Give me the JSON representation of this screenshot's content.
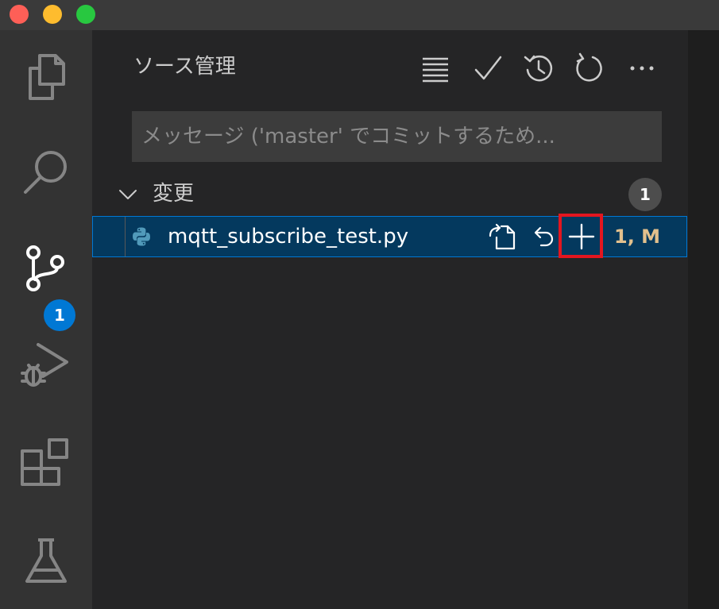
{
  "window": {
    "traffic_lights": {
      "close": "#fe5f57",
      "minimize": "#febc2e",
      "zoom": "#28c840"
    }
  },
  "activity_bar": {
    "items": [
      {
        "name": "explorer",
        "icon": "files-icon"
      },
      {
        "name": "search",
        "icon": "search-icon"
      },
      {
        "name": "source-control",
        "icon": "source-control-icon",
        "badge": "1",
        "active": true
      },
      {
        "name": "run-and-debug",
        "icon": "debug-icon"
      },
      {
        "name": "extensions",
        "icon": "extensions-icon"
      },
      {
        "name": "testing",
        "icon": "beaker-icon"
      }
    ]
  },
  "scm": {
    "title": "ソース管理",
    "toolbar_icons": [
      "list-view-icon",
      "check-icon",
      "history-icon",
      "refresh-icon",
      "more-icon"
    ],
    "commit_message": {
      "value": "",
      "placeholder": "メッセージ ('master' でコミットするため..."
    },
    "changes_group": {
      "label": "変更",
      "count": "1",
      "files": [
        {
          "name": "mqtt_subscribe_test.py",
          "language_icon": "python-icon",
          "actions": [
            "open-file-icon",
            "discard-changes-icon",
            "stage-changes-icon"
          ],
          "highlighted_action": "stage-changes-icon",
          "status": "1, M"
        }
      ]
    }
  },
  "colors": {
    "activity_bar_bg": "#333333",
    "sidebar_bg": "#252526",
    "selection_bg": "#04395e",
    "selection_border": "#0078d4",
    "badge_bg": "#0078d4",
    "highlight_box": "#e3161f",
    "modified_status": "#e2c08d"
  }
}
